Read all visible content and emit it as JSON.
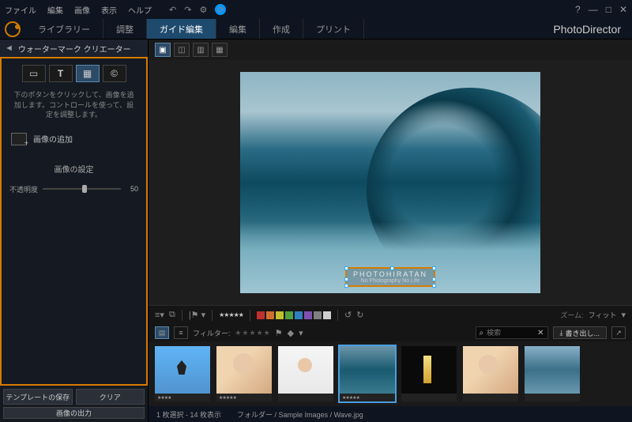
{
  "menu": {
    "file": "ファイル",
    "edit": "編集",
    "image": "画像",
    "view": "表示",
    "help": "ヘルプ"
  },
  "tabs": {
    "library": "ライブラリー",
    "adjust": "調整",
    "guided": "ガイド編集",
    "edit2": "編集",
    "create": "作成",
    "print": "プリント"
  },
  "brand": "PhotoDirector",
  "side": {
    "title": "ウォーターマーク クリエーター",
    "hint": "下のボタンをクリックして、画像を追加します。コントロールを使って、設定を調整します。",
    "add_image": "画像の追加",
    "settings": "画像の設定",
    "opacity_label": "不透明度",
    "opacity_value": "50",
    "save_template": "テンプレートの保存",
    "clear": "クリア",
    "export": "画像の出力"
  },
  "watermark": {
    "line1": "PHOTOHIRATAN",
    "line2": "No Photography No Life"
  },
  "toolbar": {
    "stars": "★★★★★",
    "flag": "|⚑ ▾",
    "zoom": "ズーム:",
    "fit": "フィット"
  },
  "filterbar": {
    "label": "フィルター:",
    "search_icon": "⌕",
    "search_placeholder": "検索",
    "export": "書き出し..."
  },
  "colors": [
    "#c03030",
    "#d07030",
    "#c0c030",
    "#50a040",
    "#3080c0",
    "#8050b0",
    "#808080",
    "#d0d0d0"
  ],
  "thumbs": [
    {
      "stars": "★★★★"
    },
    {
      "stars": "★★★★★"
    },
    {
      "stars": ""
    },
    {
      "stars": "★★★★★",
      "selected": true
    },
    {
      "stars": ""
    },
    {
      "stars": ""
    },
    {
      "stars": ""
    }
  ],
  "status": {
    "selection": "1 枚選択 - 14 枚表示",
    "path_label": "フォルダー",
    "path": "/ Sample Images / Wave.jpg"
  }
}
